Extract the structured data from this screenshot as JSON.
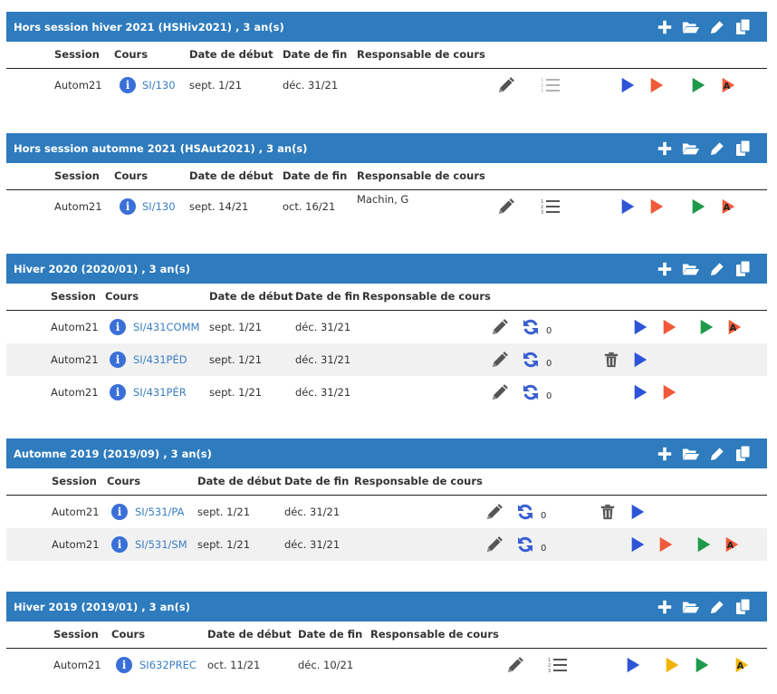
{
  "columns": {
    "session": "Session",
    "cours": "Cours",
    "debut": "Date de début",
    "fin": "Date de fin",
    "responsable": "Responsable de cours"
  },
  "colors": {
    "header_bg": "#2e7bbd",
    "play_blue": "#2e55d6",
    "play_orange": "#f05a3a",
    "play_green": "#1e9a4a",
    "play_yellow": "#f0b400",
    "sync_blue": "#3a5fd0",
    "icon_gray": "#555555"
  },
  "sections": [
    {
      "title": "Hors session hiver 2021 (HSHiv2021) , 3 an(s)",
      "rows": [
        {
          "session": "Autom21",
          "cours": "SI/130",
          "debut": "sept. 1/21",
          "fin": "déc. 31/21",
          "responsable": ""
        }
      ]
    },
    {
      "title": "Hors session automne 2021 (HSAut2021) , 3 an(s)",
      "rows": [
        {
          "session": "Autom21",
          "cours": "SI/130",
          "debut": "sept. 14/21",
          "fin": "oct. 16/21",
          "responsable": "Machin, G"
        }
      ]
    },
    {
      "title": "Hiver 2020 (2020/01) , 3 an(s)",
      "rows": [
        {
          "session": "Autom21",
          "cours": "SI/431COMM",
          "debut": "sept. 1/21",
          "fin": "déc. 31/21",
          "count": "0"
        },
        {
          "session": "Autom21",
          "cours": "SI/431PÉD",
          "debut": "sept. 1/21",
          "fin": "déc. 31/21",
          "count": "0"
        },
        {
          "session": "Autom21",
          "cours": "SI/431PÉR",
          "debut": "sept. 1/21",
          "fin": "déc. 31/21",
          "count": "0"
        }
      ]
    },
    {
      "title": "Automne 2019 (2019/09) , 3 an(s)",
      "rows": [
        {
          "session": "Autom21",
          "cours": "SI/531/PA",
          "debut": "sept. 1/21",
          "fin": "déc. 31/21",
          "count": "0"
        },
        {
          "session": "Autom21",
          "cours": "SI/531/SM",
          "debut": "sept. 1/21",
          "fin": "déc. 31/21",
          "count": "0"
        }
      ]
    },
    {
      "title": "Hiver 2019 (2019/01) , 3 an(s)",
      "rows": [
        {
          "session": "Autom21",
          "cours": "SI632PREC",
          "debut": "oct. 11/21",
          "fin": "déc. 10/21",
          "responsable": ""
        }
      ]
    }
  ]
}
